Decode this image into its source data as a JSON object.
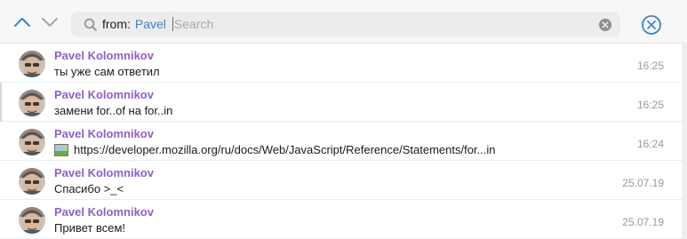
{
  "search": {
    "filter_prefix": "from:",
    "filter_user": "Pavel",
    "placeholder": "Search",
    "value": ""
  },
  "results": [
    {
      "sender": "Pavel Kolomnikov",
      "text": "ты уже сам ответил",
      "time": "16:25",
      "has_image_icon": false
    },
    {
      "sender": "Pavel Kolomnikov",
      "text": "замени for..of на for..in",
      "time": "16:25",
      "has_image_icon": false
    },
    {
      "sender": "Pavel Kolomnikov",
      "text": "https://developer.mozilla.org/ru/docs/Web/JavaScript/Reference/Statements/for...in",
      "time": "16:24",
      "has_image_icon": true
    },
    {
      "sender": "Pavel Kolomnikov",
      "text": "Спасибо >_<",
      "time": "25.07.19",
      "has_image_icon": false
    },
    {
      "sender": "Pavel Kolomnikov",
      "text": "Привет всем!",
      "time": "25.07.19",
      "has_image_icon": false
    }
  ],
  "icons": {
    "nav_up": "chevron-up-icon",
    "nav_down": "chevron-down-icon",
    "search": "search-icon",
    "clear": "clear-icon",
    "close": "close-circle-icon",
    "image": "image-icon"
  },
  "colors": {
    "sender_name": "#8e5fc7",
    "accent_blue": "#3b86c9",
    "time": "#9a9a9a"
  }
}
